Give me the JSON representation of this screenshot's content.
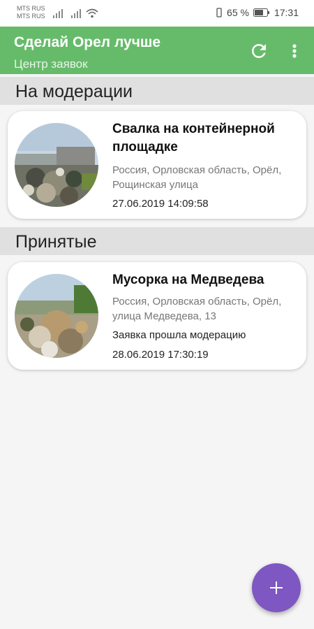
{
  "status_bar": {
    "carrier_1": "MTS RUS",
    "carrier_2": "MTS RUS",
    "battery": "65 %",
    "time": "17:31"
  },
  "app_bar": {
    "title": "Сделай Орел лучше",
    "subtitle": "Центр заявок",
    "icons": [
      "refresh-icon",
      "more-vert-icon"
    ]
  },
  "sections": [
    {
      "title": "На модерации",
      "items": [
        {
          "title": "Свалка на контейнерной площадке",
          "address": "Россия, Орловская область, Орёл, Рощинская улица",
          "status": "",
          "date": "27.06.2019 14:09:58"
        }
      ]
    },
    {
      "title": "Принятые",
      "items": [
        {
          "title": "Мусорка на Медведева",
          "address": "Россия, Орловская область, Орёл, улица Медведева, 13",
          "status": "Заявка прошла модерацию",
          "date": "28.06.2019 17:30:19"
        }
      ]
    }
  ],
  "fab": {
    "label": "+",
    "icon": "add-icon"
  },
  "colors": {
    "app_bar": "#66bb6a",
    "fab": "#7e57c2",
    "section_bg": "#e0e0e0"
  }
}
